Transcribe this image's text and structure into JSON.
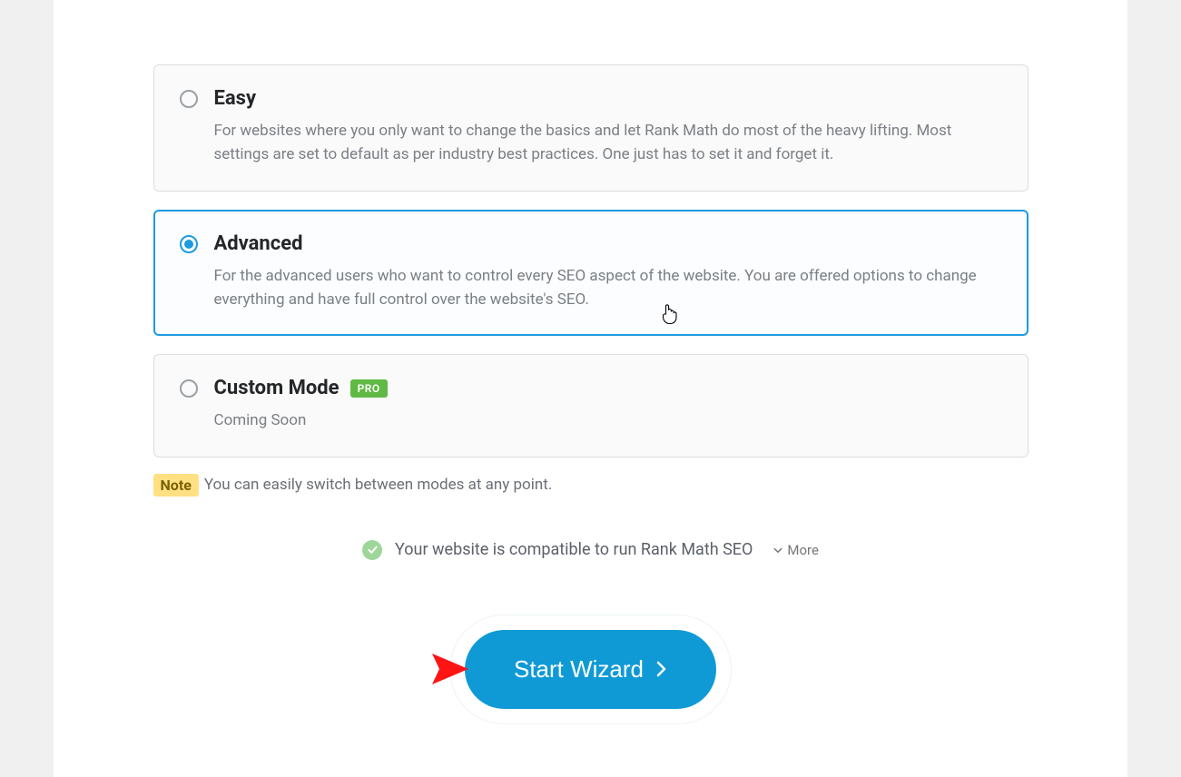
{
  "modes": {
    "easy": {
      "title": "Easy",
      "desc": "For websites where you only want to change the basics and let Rank Math do most of the heavy lifting. Most settings are set to default as per industry best practices. One just has to set it and forget it."
    },
    "advanced": {
      "title": "Advanced",
      "desc": "For the advanced users who want to control every SEO aspect of the website. You are offered options to change everything and have full control over the website's SEO."
    },
    "custom": {
      "title": "Custom Mode",
      "badge": "PRO",
      "desc": "Coming Soon"
    }
  },
  "note": {
    "badge": "Note",
    "text": "You can easily switch between modes at any point."
  },
  "compat": {
    "text": "Your website is compatible to run Rank Math SEO",
    "more": "More"
  },
  "cta": {
    "label": "Start Wizard"
  }
}
